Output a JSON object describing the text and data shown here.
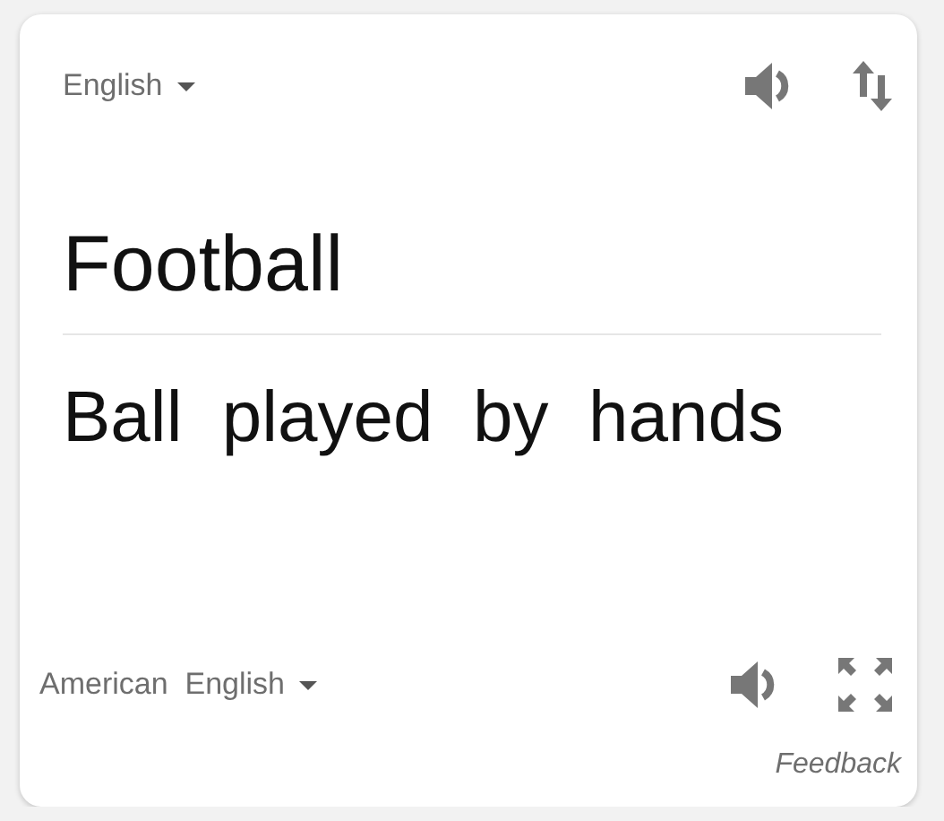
{
  "source": {
    "language": "English",
    "text": "Football"
  },
  "target": {
    "language": "American  English",
    "text": "Ball  played  by  hands"
  },
  "feedback": "Feedback"
}
